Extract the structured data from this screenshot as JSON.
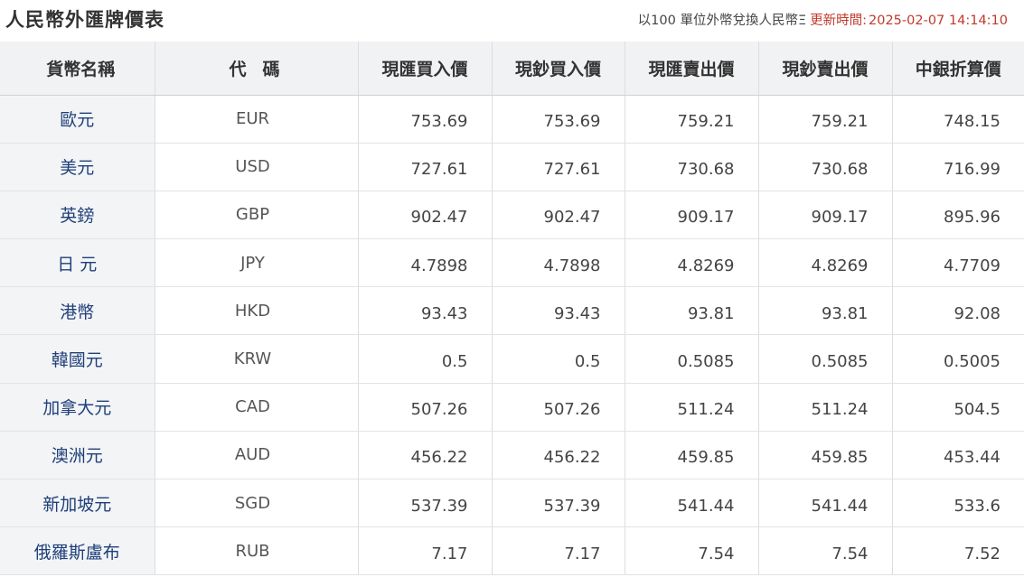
{
  "header": {
    "title": "人民幣外匯牌價表",
    "note": "以100 單位外幣兌換人民幣Ξ",
    "update_label": "更新時間:",
    "update_time": "2025-02-07 14:14:10"
  },
  "table": {
    "columns": [
      "貨幣名稱",
      "代碼",
      "現匯買入價",
      "現鈔買入價",
      "現匯賣出價",
      "現鈔賣出價",
      "中銀折算價"
    ],
    "rows": [
      {
        "name": "歐元",
        "code": "EUR",
        "spot_buy": "753.69",
        "cash_buy": "753.69",
        "spot_sell": "759.21",
        "cash_sell": "759.21",
        "boc_rate": "748.15"
      },
      {
        "name": "美元",
        "code": "USD",
        "spot_buy": "727.61",
        "cash_buy": "727.61",
        "spot_sell": "730.68",
        "cash_sell": "730.68",
        "boc_rate": "716.99"
      },
      {
        "name": "英鎊",
        "code": "GBP",
        "spot_buy": "902.47",
        "cash_buy": "902.47",
        "spot_sell": "909.17",
        "cash_sell": "909.17",
        "boc_rate": "895.96"
      },
      {
        "name": "日 元",
        "code": "JPY",
        "spot_buy": "4.7898",
        "cash_buy": "4.7898",
        "spot_sell": "4.8269",
        "cash_sell": "4.8269",
        "boc_rate": "4.7709"
      },
      {
        "name": "港幣",
        "code": "HKD",
        "spot_buy": "93.43",
        "cash_buy": "93.43",
        "spot_sell": "93.81",
        "cash_sell": "93.81",
        "boc_rate": "92.08"
      },
      {
        "name": "韓國元",
        "code": "KRW",
        "spot_buy": "0.5",
        "cash_buy": "0.5",
        "spot_sell": "0.5085",
        "cash_sell": "0.5085",
        "boc_rate": "0.5005"
      },
      {
        "name": "加拿大元",
        "code": "CAD",
        "spot_buy": "507.26",
        "cash_buy": "507.26",
        "spot_sell": "511.24",
        "cash_sell": "511.24",
        "boc_rate": "504.5"
      },
      {
        "name": "澳洲元",
        "code": "AUD",
        "spot_buy": "456.22",
        "cash_buy": "456.22",
        "spot_sell": "459.85",
        "cash_sell": "459.85",
        "boc_rate": "453.44"
      },
      {
        "name": "新加坡元",
        "code": "SGD",
        "spot_buy": "537.39",
        "cash_buy": "537.39",
        "spot_sell": "541.44",
        "cash_sell": "541.44",
        "boc_rate": "533.6"
      },
      {
        "name": "俄羅斯盧布",
        "code": "RUB",
        "spot_buy": "7.17",
        "cash_buy": "7.17",
        "spot_sell": "7.54",
        "cash_sell": "7.54",
        "boc_rate": "7.52"
      }
    ]
  }
}
